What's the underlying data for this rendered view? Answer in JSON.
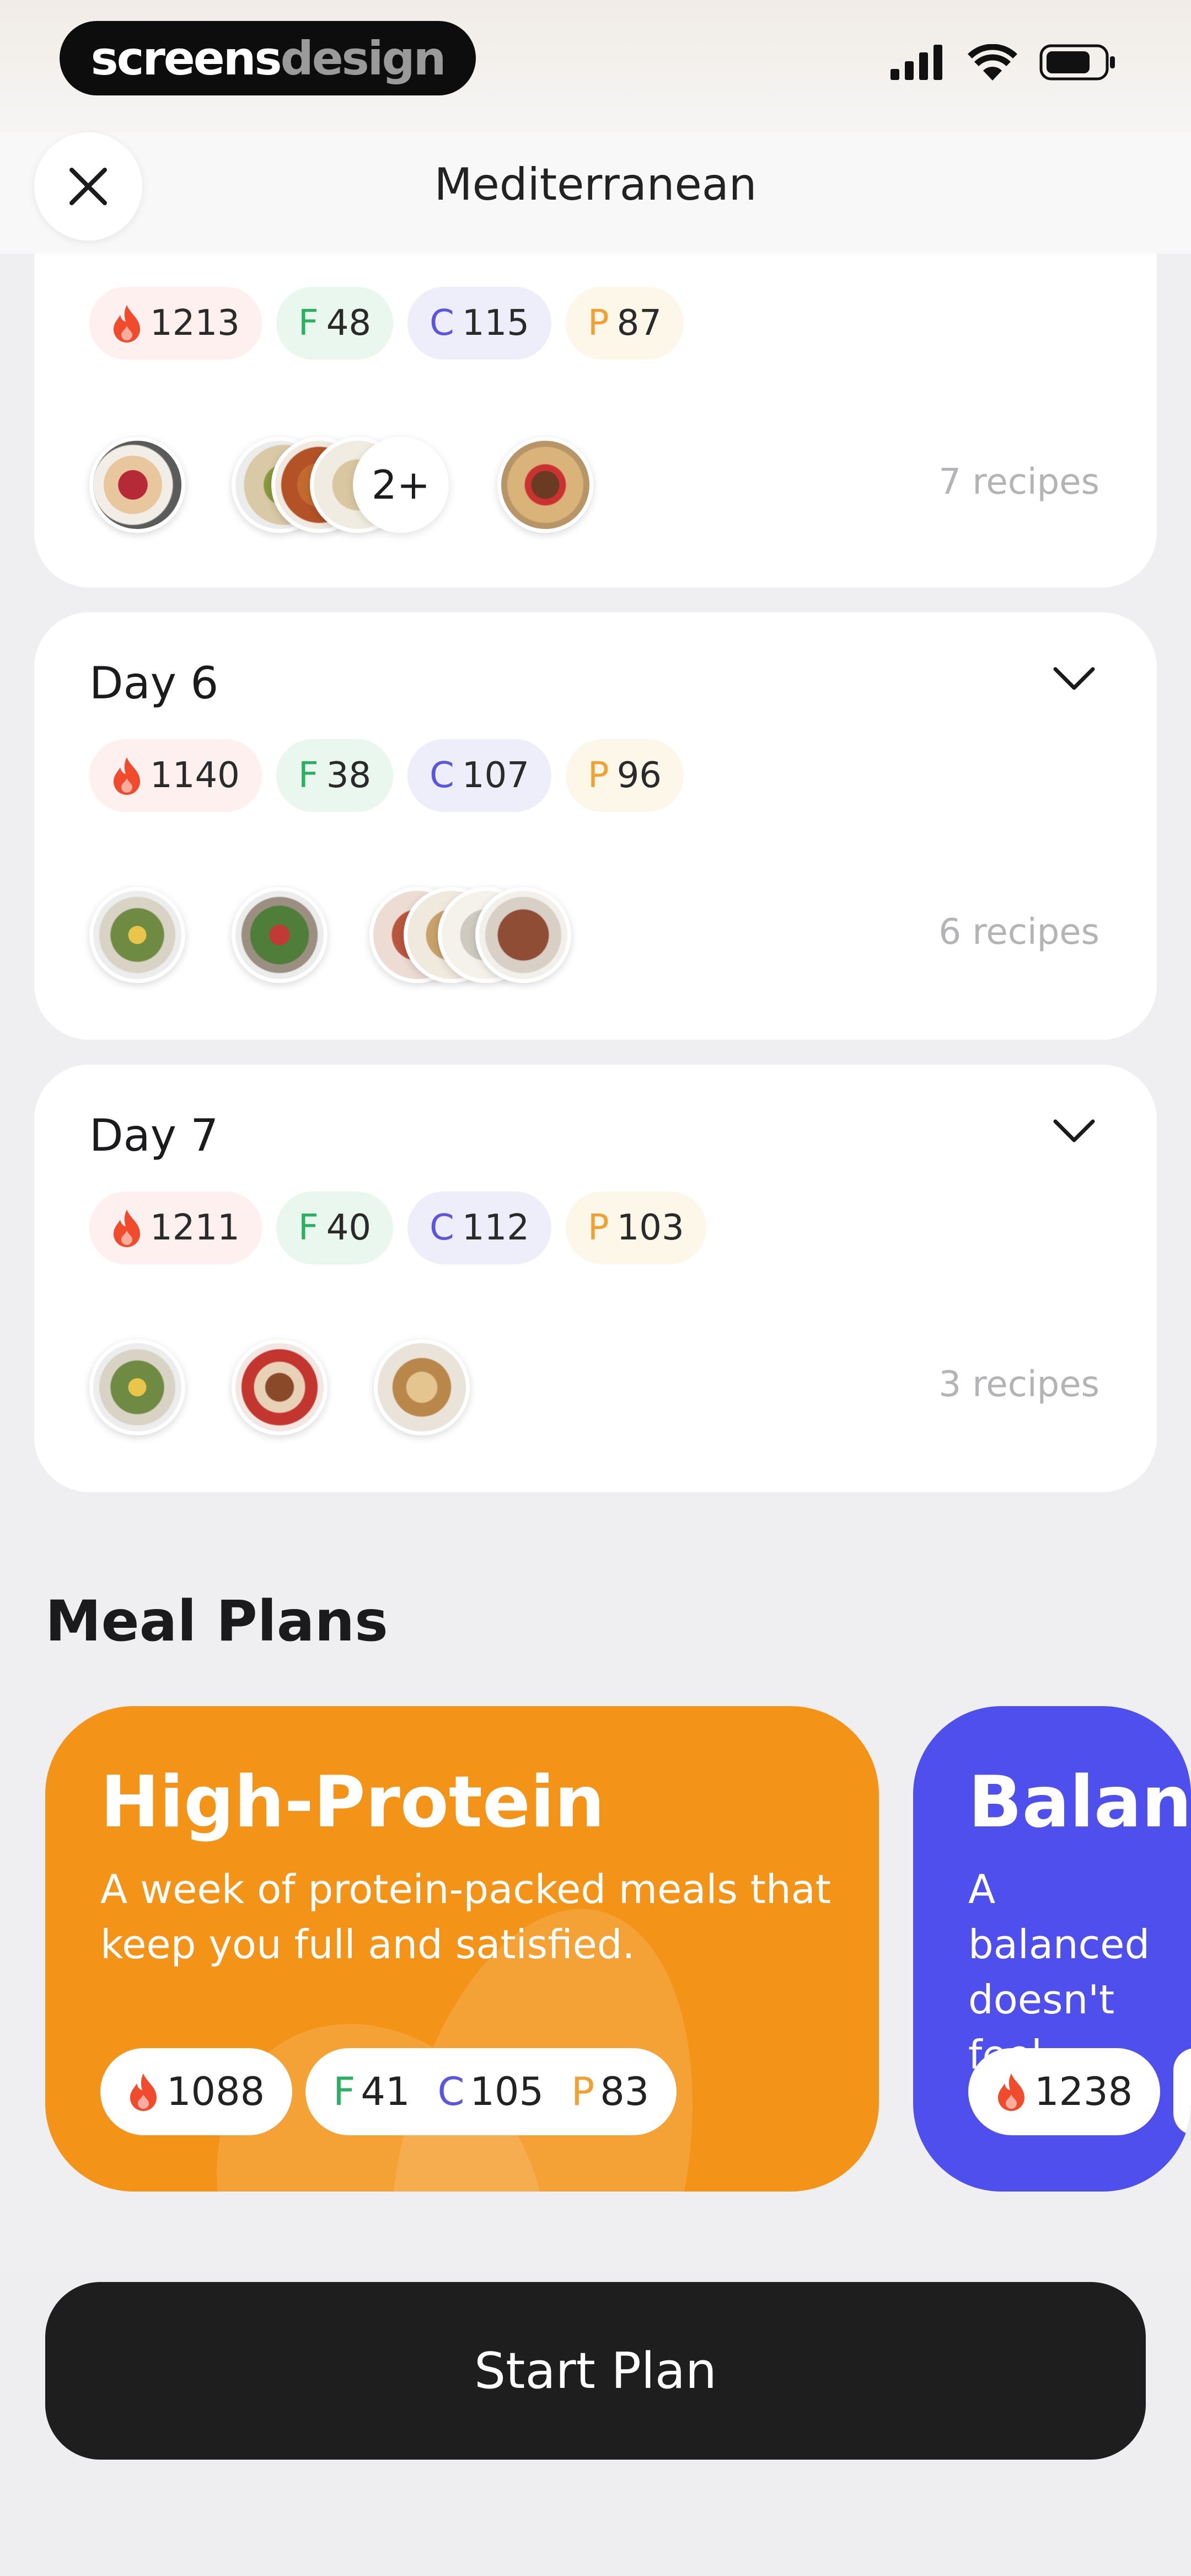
{
  "status_bar": {
    "brand_part1": "screens",
    "brand_part2": "design",
    "icons": [
      "signal-icon",
      "wifi-icon",
      "battery-icon"
    ]
  },
  "header": {
    "title": "Mediterranean",
    "close_icon": "close-icon"
  },
  "days": [
    {
      "title": "",
      "calories": "1213",
      "fat": "48",
      "carbs": "115",
      "protein": "87",
      "more_badge": "2+",
      "recipes": "7 recipes"
    },
    {
      "title": "Day 6",
      "calories": "1140",
      "fat": "38",
      "carbs": "107",
      "protein": "96",
      "recipes": "6 recipes"
    },
    {
      "title": "Day 7",
      "calories": "1211",
      "fat": "40",
      "carbs": "112",
      "protein": "103",
      "recipes": "3 recipes"
    }
  ],
  "macro_letters": {
    "fat": "F",
    "carbs": "C",
    "protein": "P"
  },
  "meal_plans": {
    "section_title": "Meal Plans",
    "plans": [
      {
        "title": "High-Protein",
        "description": "A week of protein-packed meals that keep you full and satisfied.",
        "calories": "1088",
        "fat": "41",
        "carbs": "105",
        "protein": "83",
        "color": "#f39419"
      },
      {
        "title": "Balanc",
        "description": "A balanced doesn't feel",
        "calories": "1238",
        "color": "#4f4fed"
      }
    ]
  },
  "footer": {
    "start_label": "Start Plan"
  },
  "colors": {
    "fire": "#ef4b2c",
    "fat": "#2bb061",
    "carbs": "#5b55e0",
    "protein": "#f1a032",
    "button": "#1e1e1e"
  }
}
